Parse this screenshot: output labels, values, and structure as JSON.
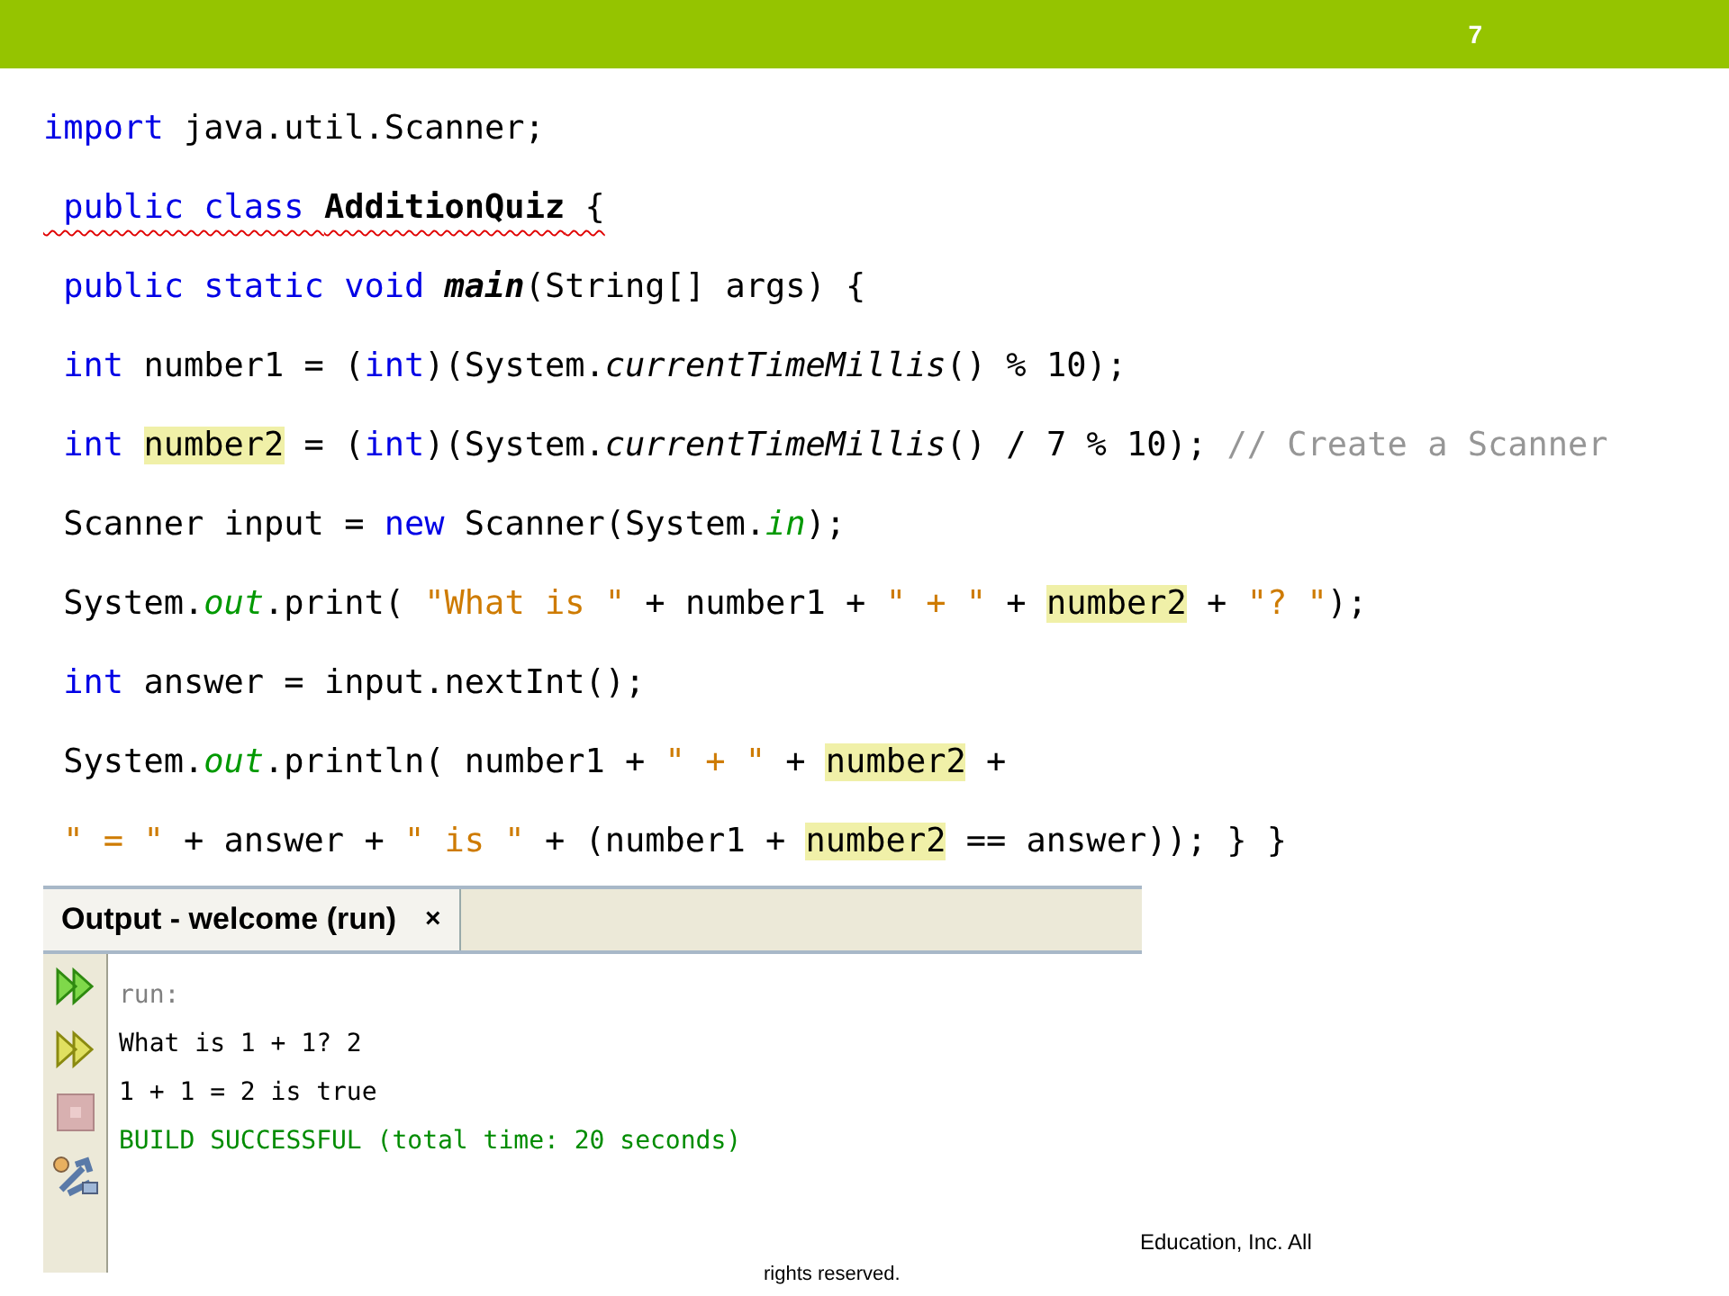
{
  "slide_number": "7",
  "code": [
    {
      "error": false,
      "segments": [
        {
          "kind": "keyword",
          "text": "import"
        },
        {
          "kind": "plain",
          "text": " java.util.Scanner;"
        }
      ]
    },
    {
      "error": true,
      "segments": [
        {
          "kind": "keyword",
          "text": " public class "
        },
        {
          "kind": "bold",
          "text": "AdditionQuiz"
        },
        {
          "kind": "plain",
          "text": " {"
        }
      ]
    },
    {
      "error": false,
      "segments": [
        {
          "kind": "keyword",
          "text": " public static void "
        },
        {
          "kind": "bold_italic",
          "text": "main"
        },
        {
          "kind": "plain",
          "text": "(String[] args) {"
        }
      ]
    },
    {
      "error": false,
      "segments": [
        {
          "kind": "keyword",
          "text": " int"
        },
        {
          "kind": "plain",
          "text": " number1 = ("
        },
        {
          "kind": "keyword",
          "text": "int"
        },
        {
          "kind": "plain",
          "text": ")(System."
        },
        {
          "kind": "italic",
          "text": "currentTimeMillis"
        },
        {
          "kind": "plain",
          "text": "() % 10);"
        }
      ]
    },
    {
      "error": false,
      "segments": [
        {
          "kind": "keyword",
          "text": " int "
        },
        {
          "kind": "highlight",
          "text": "number2"
        },
        {
          "kind": "plain",
          "text": " = ("
        },
        {
          "kind": "keyword",
          "text": "int"
        },
        {
          "kind": "plain",
          "text": ")(System."
        },
        {
          "kind": "italic",
          "text": "currentTimeMillis"
        },
        {
          "kind": "plain",
          "text": "() / 7 % 10); "
        },
        {
          "kind": "comment",
          "text": "// Create a Scanner"
        }
      ]
    },
    {
      "error": false,
      "segments": [
        {
          "kind": "plain",
          "text": " Scanner input = "
        },
        {
          "kind": "keyword",
          "text": "new"
        },
        {
          "kind": "plain",
          "text": " Scanner(System."
        },
        {
          "kind": "field",
          "text": "in"
        },
        {
          "kind": "plain",
          "text": ");"
        }
      ]
    },
    {
      "error": false,
      "segments": [
        {
          "kind": "plain",
          "text": " System."
        },
        {
          "kind": "field",
          "text": "out"
        },
        {
          "kind": "plain",
          "text": ".print( "
        },
        {
          "kind": "string",
          "text": "\"What is \""
        },
        {
          "kind": "plain",
          "text": " + number1 + "
        },
        {
          "kind": "string",
          "text": "\" + \""
        },
        {
          "kind": "plain",
          "text": " + "
        },
        {
          "kind": "highlight",
          "text": "number2"
        },
        {
          "kind": "plain",
          "text": " + "
        },
        {
          "kind": "string",
          "text": "\"? \""
        },
        {
          "kind": "plain",
          "text": ");"
        }
      ]
    },
    {
      "error": false,
      "segments": [
        {
          "kind": "keyword",
          "text": " int"
        },
        {
          "kind": "plain",
          "text": " answer = input.nextInt();"
        }
      ]
    },
    {
      "error": false,
      "segments": [
        {
          "kind": "plain",
          "text": " System."
        },
        {
          "kind": "field",
          "text": "out"
        },
        {
          "kind": "plain",
          "text": ".println( number1 + "
        },
        {
          "kind": "string",
          "text": "\" + \""
        },
        {
          "kind": "plain",
          "text": " + "
        },
        {
          "kind": "highlight",
          "text": "number2"
        },
        {
          "kind": "plain",
          "text": " +"
        }
      ]
    },
    {
      "error": false,
      "segments": [
        {
          "kind": "string",
          "text": " \" = \""
        },
        {
          "kind": "plain",
          "text": " + answer + "
        },
        {
          "kind": "string",
          "text": "\" is \""
        },
        {
          "kind": "plain",
          "text": " + (number1 + "
        },
        {
          "kind": "highlight",
          "text": "number2"
        },
        {
          "kind": "plain",
          "text": " == answer)); } }"
        }
      ]
    }
  ],
  "output_panel": {
    "tab": {
      "label": "Output - welcome (run)",
      "close": "×",
      "selected": true
    },
    "lines": [
      {
        "kind": "info",
        "text": "run:"
      },
      {
        "kind": "normal",
        "text": "What is 1 + 1? 2"
      },
      {
        "kind": "normal",
        "text": "1 + 1 = 2 is true"
      },
      {
        "kind": "success",
        "text": "BUILD SUCCESSFUL (total time: 20 seconds)"
      }
    ]
  },
  "footer": [
    "Education, Inc. All",
    "rights reserved."
  ]
}
